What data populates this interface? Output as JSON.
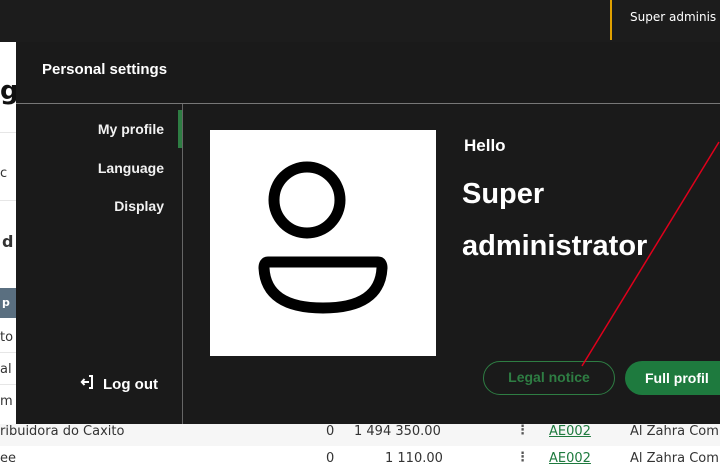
{
  "topbar": {
    "user_label": "Super adminis"
  },
  "background": {
    "title_fragment": "g",
    "fragments": [
      "c",
      "d",
      "p",
      "to",
      "al",
      "m"
    ],
    "rows": [
      {
        "name": "ribuidora do Caxito",
        "count": "0",
        "amount": "1 494 350.00",
        "code": "AE002",
        "company": "Al Zahra Comp"
      },
      {
        "name": "ee",
        "count": "0",
        "amount": "1 110.00",
        "code": "AE002",
        "company": "Al Zahra Comp"
      }
    ]
  },
  "panel": {
    "title": "Personal settings",
    "nav": [
      {
        "label": "My profile",
        "active": true
      },
      {
        "label": "Language",
        "active": false
      },
      {
        "label": "Display",
        "active": false
      }
    ],
    "logout_label": "Log out",
    "greeting": "Hello",
    "username": "Super administrator",
    "legal_label": "Legal notice",
    "full_profile_label": "Full profil"
  },
  "colors": {
    "accent": "#2e7d43",
    "panel_bg": "#1a1a1a",
    "topbar_accent": "#e0a000",
    "annotation": "#e0001b"
  },
  "icons": {
    "avatar": "user-avatar-icon",
    "logout": "logout-icon",
    "row_menu": "kebab-menu-icon"
  }
}
